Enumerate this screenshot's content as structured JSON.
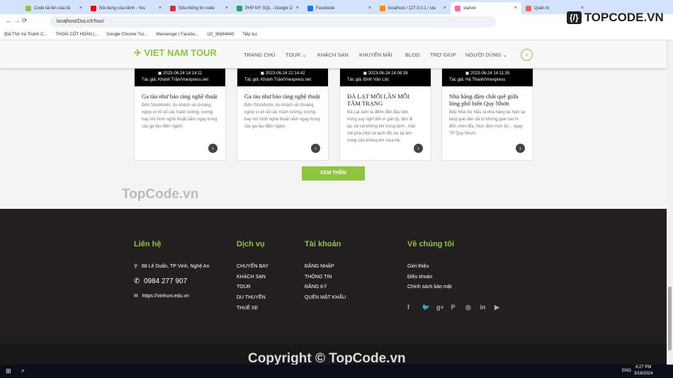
{
  "browser": {
    "tabs": [
      "Code tải lên của tôi",
      "Nội dung của kênh - You",
      "Sửa thông tin code",
      "PHP MY SQL - Google D",
      "Facebook",
      "localhost / 127.0.0.1 / sta",
      "starvel",
      "Quản trị"
    ],
    "active_tab": 6,
    "url": "localhost/DuLichTour/",
    "bookmarks": [
      "[Đã Thử Và Thành C...",
      "THOÁI CỐT HOÀN |...",
      "Google Chrome Trợ...",
      "Messenger | Facebo...",
      "i10_35684640",
      "Tiếp tục"
    ]
  },
  "site": {
    "logo": "VIET NAM TOUR",
    "nav": [
      "TRANG CHỦ",
      "TOUR ⌄",
      "KHÁCH SẠN",
      "KHUYẾN MÃI",
      "BLOG",
      "TRỢ GIÚP",
      "NGƯỜI DÙNG ⌄"
    ],
    "search_icon": "search-icon"
  },
  "cards": [
    {
      "date": "2023-06-24 14:14:11",
      "author": "Tác giả: Khánh Trần/Vnexpress.net",
      "title": "Ga tàu như bảo tàng nghệ thuật",
      "excerpt": "Đến Stockholm, du khách sẽ choáng ngợp vì vô số các tranh tường, tượng hay mô hình nghệ thuật nằm ngay trong các ga tàu điện ngầm."
    },
    {
      "date": "2023-06-24 22:14:42",
      "author": "Tác giả: Khánh Trần/Vnexpress.net",
      "title": "Ga tàu như bảo tàng nghệ thuật",
      "excerpt": "Đến Stockholm, du khách sẽ choáng ngợp vì vô số các tranh tường, tượng hay mô hình nghệ thuật nằm ngay trong các ga tàu điện ngầm."
    },
    {
      "date": "2023-06-24 14:08:39",
      "author": "Tác giả: Đinh Văn Lộc",
      "title": "ĐÀ LẠT MỖI LẦN MỖI TÂM TRẠNG",
      "excerpt": "Đà Lạt luôn là điểm đến đầu tiên trong suy nghĩ bởi vì gần tp, tiện đi lại, và cái không khí trong lành , mát mẻ pha chút se lạnh đôi lúc lại ấm nóng của không khí mùa hè,"
    },
    {
      "date": "2023-06-24 14:11:35",
      "author": "Tác giả: Hà Thanh/Vnexpress",
      "title": "Nhà hàng đậm chất quê giữa lòng phố biển Quy Nhơn",
      "excerpt": "Bếp Nhà Xứ Nẫu là nhà hàng tái hiện lại làng quê dân dã từ không gian bài trí đến chén đĩa, thực đơn món ăn... ngay TP Quy Nhơn."
    }
  ],
  "more_label": "XEM THÊM",
  "footer": {
    "contact_title": "Liên hệ",
    "address": "88 Lê Duẩn, TP Vinh, Nghệ An",
    "phone": "0984 277 907",
    "website": "https://vinhuni.edu.vn",
    "services_title": "Dịch vụ",
    "services": [
      "CHUYẾN BAY",
      "KHÁCH SẠN",
      "TOUR",
      "DU THUYỀN",
      "THUÊ XE"
    ],
    "account_title": "Tài khoản",
    "account": [
      "ĐĂNG NHẬP",
      "THÔNG TIN",
      "ĐĂNG KÝ",
      "QUÊN MẬT KHẨU"
    ],
    "about_title": "Về chúng tôi",
    "about": [
      "Giới thiệu",
      "Điều khoản",
      "Chính sách bảo mật"
    ],
    "social": [
      "f",
      "🐦",
      "g+",
      "P",
      "◎",
      "in",
      "▶"
    ]
  },
  "watermark": "TopCode.vn",
  "copyright": "Copyright © TopCode.vn",
  "topcode_logo": "TOPCODE.VN",
  "taskbar": {
    "time": "4:27 PM",
    "date": "3/18/2024",
    "lang": "ENG"
  }
}
